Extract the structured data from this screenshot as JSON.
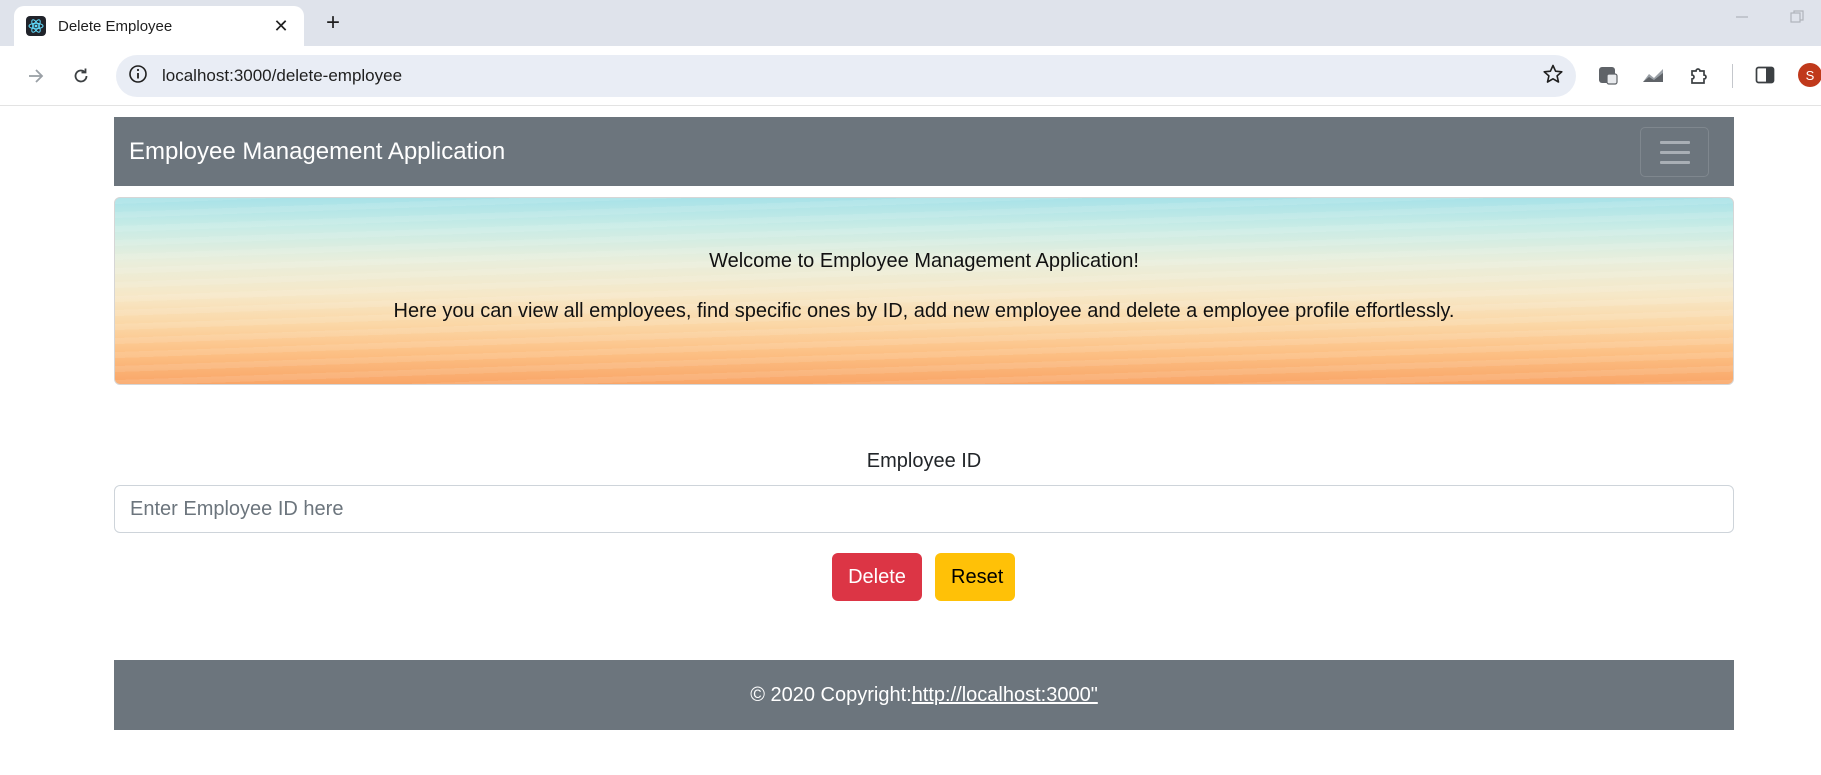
{
  "browser": {
    "tab_title": "Delete Employee",
    "tab_close": "✕",
    "new_tab": "+",
    "url": "localhost:3000/delete-employee",
    "profile_initial": "S"
  },
  "navbar": {
    "brand": "Employee Management Application"
  },
  "hero": {
    "welcome": "Welcome to Employee Management Application!",
    "description": "Here you can view all employees, find specific ones by ID, add new employee and delete a employee profile effortlessly."
  },
  "form": {
    "label": "Employee ID",
    "placeholder": "Enter Employee ID here",
    "value": "",
    "delete_label": "Delete",
    "reset_label": "Reset"
  },
  "footer": {
    "copyright": "© 2020 Copyright:",
    "link_text": "http://localhost:3000\""
  },
  "colors": {
    "navbar_bg": "#6c757d",
    "delete_bg": "#dc3545",
    "reset_bg": "#ffc107"
  }
}
